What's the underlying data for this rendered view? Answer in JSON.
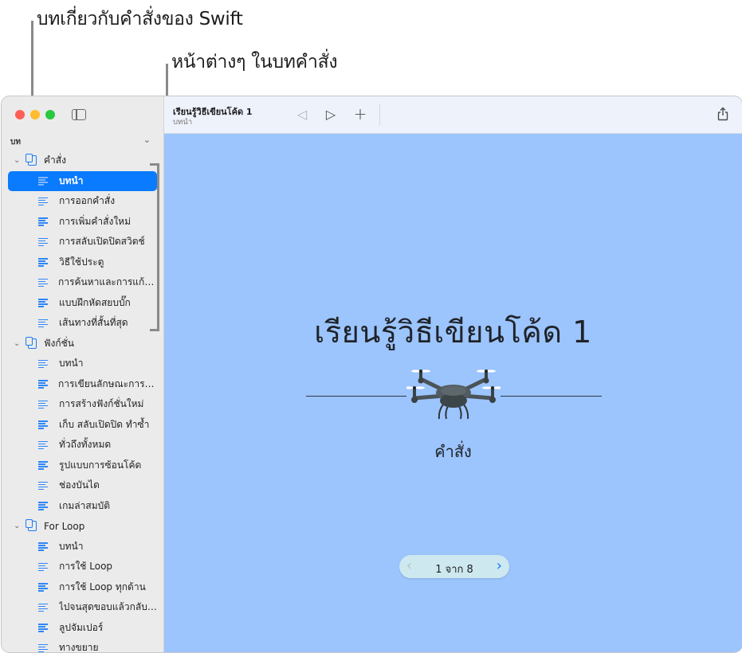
{
  "callouts": {
    "chapter_about_commands": "บทเกี่ยวกับคำสั่งของ Swift",
    "pages_in_chapter": "หน้าต่างๆ ในบทคำสั่ง"
  },
  "window": {
    "toolbar": {
      "title": "เรียนรู้วิธีเขียนโค้ด 1",
      "subtitle": "บทนำ",
      "icons": {
        "back": "triangle-left-icon",
        "forward": "triangle-right-icon",
        "add": "plus-icon",
        "share": "share-icon"
      },
      "back_glyph": "◁",
      "forward_glyph": "▷",
      "add_glyph": "+"
    },
    "sidebar": {
      "section_label": "บท",
      "chapters": [
        {
          "title": "คำสั่ง",
          "expanded": true,
          "pages": [
            "บทนำ",
            "การออกคำสั่ง",
            "การเพิ่มคำสั่งใหม่",
            "การสลับเปิดปิดสวิตช์",
            "วิธีใช้ประตู",
            "การค้นหาและการแก้ไขบั๊ก",
            "แบบฝึกหัดสยบบั๊ก",
            "เส้นทางที่สั้นที่สุด"
          ]
        },
        {
          "title": "ฟังก์ชั่น",
          "expanded": true,
          "pages": [
            "บทนำ",
            "การเขียนลักษณะการทำงาน",
            "การสร้างฟังก์ชั่นใหม่",
            "เก็บ สลับเปิดปิด ทำซ้ำ",
            "ทั่วถึงทั้งหมด",
            "รูปแบบการซ้อนโค้ด",
            "ช่องบันได",
            "เกมล่าสมบัติ"
          ]
        },
        {
          "title": "For Loop",
          "expanded": true,
          "pages": [
            "บทนำ",
            "การใช้ Loop",
            "การใช้ Loop ทุกด้าน",
            "ไปจนสุดขอบแล้วกลับมา",
            "ลูปจัมเปอร์",
            "ทางขยาย"
          ]
        }
      ],
      "selected": {
        "chapter": 0,
        "page": 0
      }
    },
    "content": {
      "title": "เรียนรู้วิธีเขียนโค้ด 1",
      "subtitle": "คำสั่ง",
      "illustration": "drone",
      "pager": {
        "current": 1,
        "total": 8,
        "label": "1 จาก 8",
        "prev_glyph": "‹",
        "next_glyph": "›"
      },
      "colors": {
        "background": "#9cc4fd",
        "accent": "#0a7aff"
      }
    }
  }
}
